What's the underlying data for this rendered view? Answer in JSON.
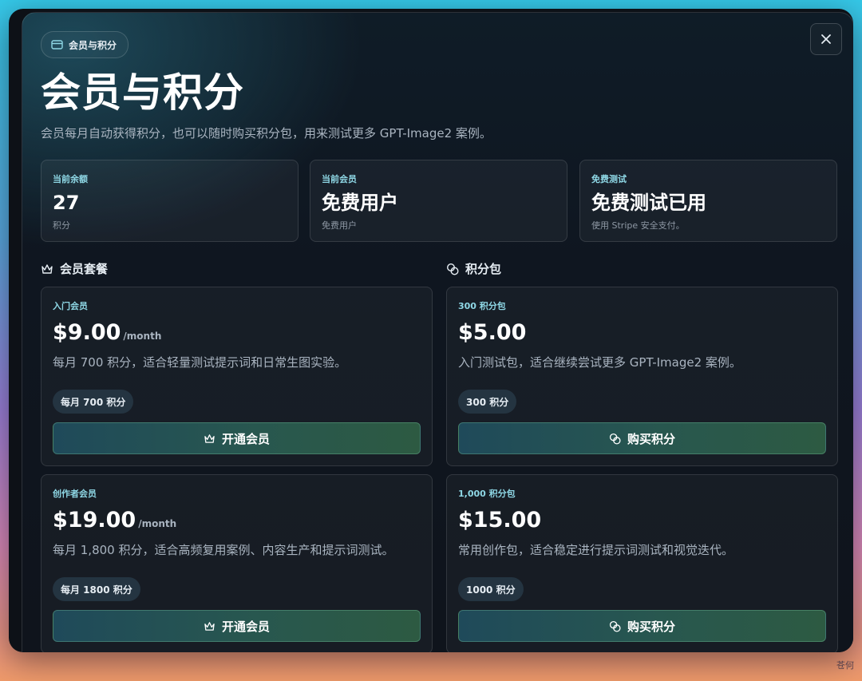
{
  "modal": {
    "badge_label": "会员与积分",
    "title": "会员与积分",
    "subtitle": "会员每月自动获得积分，也可以随时购买积分包，用来测试更多 GPT-Image2 案例。"
  },
  "stats": [
    {
      "label": "当前余额",
      "value": "27",
      "note": "积分"
    },
    {
      "label": "当前会员",
      "value": "免费用户",
      "note": "免费用户"
    },
    {
      "label": "免费测试",
      "value": "免费测试已用",
      "note": "使用 Stripe 安全支付。"
    }
  ],
  "sections": {
    "membership": "会员套餐",
    "packs": "积分包"
  },
  "plans": [
    {
      "name": "入门会员",
      "price": "$9.00",
      "period": "/month",
      "desc": "每月 700 积分，适合轻量测试提示词和日常生图实验。",
      "chip": "每月 700 积分",
      "button": "开通会员"
    },
    {
      "name": "创作者会员",
      "price": "$19.00",
      "period": "/month",
      "desc": "每月 1,800 积分，适合高频复用案例、内容生产和提示词测试。",
      "chip": "每月 1800 积分",
      "button": "开通会员"
    }
  ],
  "packs": [
    {
      "name": "300 积分包",
      "price": "$5.00",
      "desc": "入门测试包，适合继续尝试更多 GPT-Image2 案例。",
      "chip": "300 积分",
      "button": "购买积分"
    },
    {
      "name": "1,000 积分包",
      "price": "$15.00",
      "desc": "常用创作包，适合稳定进行提示词测试和视觉迭代。",
      "chip": "1000 积分",
      "button": "购买积分"
    }
  ],
  "icons": {
    "close": "close-icon",
    "badge": "credit-card-icon",
    "membership": "crown-icon",
    "packs": "coins-icon"
  },
  "colors": {
    "accent": "#8fd8e6",
    "button_start": "#1f4a5a",
    "button_end": "#2d5a42",
    "background": "#0f1620"
  },
  "watermark": "苍何"
}
